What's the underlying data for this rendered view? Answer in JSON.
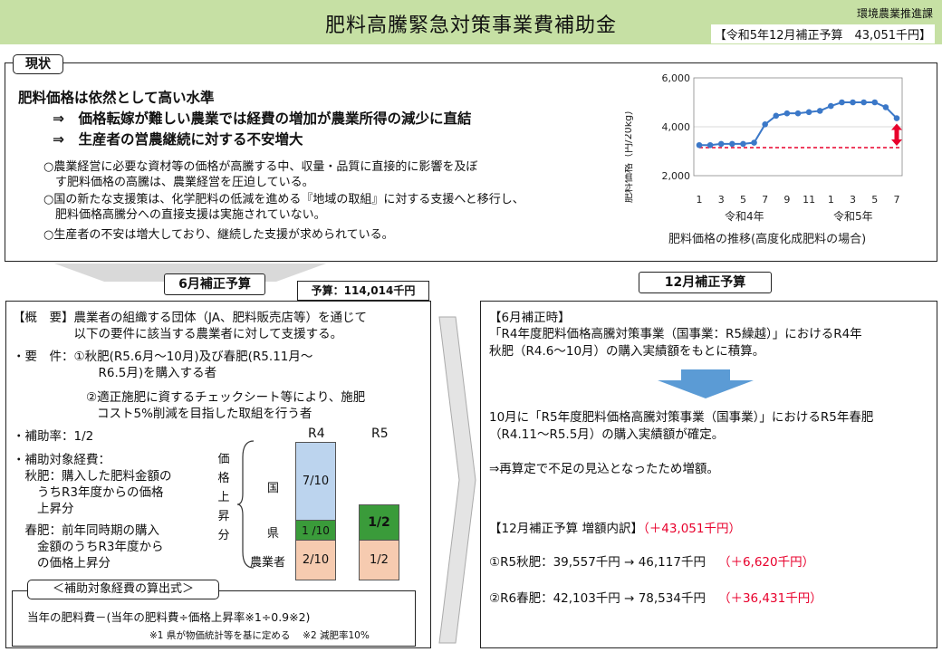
{
  "header": {
    "title": "肥料高騰緊急対策事業費補助金",
    "department": "環境農業推進課",
    "budget": "【令和5年12月補正予算　43,051千円】"
  },
  "status": {
    "label": "現状",
    "headline": "肥料価格は依然として高い水準",
    "sub1": "⇒　価格転嫁が難しい農業では経費の増加が農業所得の減少に直結",
    "sub2": "⇒　生産者の営農継続に対する不安増大",
    "bullets": [
      "○農業経営に必要な資材等の価格が高騰する中、収量・品質に直接的に影響を及ぼ",
      "　す肥料価格の高騰は、農業経営を圧迫している。",
      "○国の新たな支援策は、化学肥料の低減を進める『地域の取組』に対する支援へと移行し、",
      "　肥料価格高騰分への直接支援は実施されていない。",
      "○生産者の不安は増大しており、継続した支援が求められている。"
    ]
  },
  "chart_data": {
    "type": "line",
    "title": "肥料価格の推移(高度化成肥料の場合)",
    "ylabel": "肥料価格（円/20kg）",
    "ylim": [
      2000,
      6000
    ],
    "yticks": [
      "6,000",
      "4,000",
      "2,000"
    ],
    "xtick_labels": [
      "1",
      "3",
      "5",
      "7",
      "9",
      "11",
      "1",
      "3",
      "5",
      "7"
    ],
    "year_labels": [
      "令和4年",
      "令和5年"
    ],
    "x": [
      "R4.1",
      "R4.2",
      "R4.3",
      "R4.4",
      "R4.5",
      "R4.6",
      "R4.7",
      "R4.8",
      "R4.9",
      "R4.10",
      "R4.11",
      "R4.12",
      "R5.1",
      "R5.2",
      "R5.3",
      "R5.4",
      "R5.5",
      "R5.6",
      "R5.7"
    ],
    "values": [
      3250,
      3250,
      3300,
      3300,
      3300,
      3350,
      4100,
      4450,
      4550,
      4550,
      4600,
      4650,
      4850,
      5000,
      5000,
      5000,
      5000,
      4800,
      4350
    ],
    "reference_line": 3150,
    "grid": true,
    "colors": {
      "line": "#3b78c8",
      "reference": "#e8002c",
      "arrow": "#e8002c"
    }
  },
  "june": {
    "label": "6月補正予算",
    "budget": "予算：114,014千円",
    "overview1": "【概　要】農業者の組織する団体（JA、肥料販売店等）を通じて",
    "overview2": "　　　　　以下の要件に該当する農業者に対して支援する。",
    "req1": "・要　件：①秋肥(R5.6月～10月)及び春肥(R5.11月～",
    "req2": "　　　　　　　R6.5月)を購入する者",
    "req3": "②適正施肥に資するチェックシート等により、施肥",
    "req4": "コスト5%削減を目指した取組を行う者",
    "rate": "・補助率：1/2",
    "costs1": "・補助対象経費：",
    "costs2": "　秋肥：購入した肥料金額の",
    "costs3": "　　うちR3年度からの価格",
    "costs4": "　　上昇分",
    "costs5": "　春肥：前年同時期の購入",
    "costs6": "　　金額のうちR3年度から",
    "costs7": "　　の価格上昇分",
    "vertical_label": "価格上昇分",
    "r4": "R4",
    "r5": "R5",
    "row_national": "国",
    "row_pref": "県",
    "row_farmer": "農業者",
    "cell_national": "7/10",
    "cell_pref": "1 /10",
    "cell_farmer": "2/10",
    "cell_pref_r5": "1/2",
    "cell_farmer_r5": "1/2",
    "formula_label": "＜補助対象経費の算出式＞",
    "formula": "当年の肥料費－(当年の肥料費÷価格上昇率※1÷0.9※2)",
    "note": "※1 県が物価統計等を基に定める　 ※2 減肥率10%",
    "colors": {
      "national": "#bcd4ee",
      "pref": "#3a9b3a",
      "farmer": "#f6cbb0"
    }
  },
  "december": {
    "label": "12月補正予算",
    "p1": "【6月補正時】",
    "p2": "「R4年度肥料価格高騰対策事業（国事業：R5繰越）」におけるR4年",
    "p3": "秋肥（R4.6～10月）の購入実績額をもとに積算。",
    "p4": "10月に「R5年度肥料価格高騰対策事業（国事業）」におけるR5年春肥",
    "p5": "（R4.11～R5.5月）の購入実績額が確定。",
    "p6": "⇒再算定で不足の見込となったため増額。",
    "breakdown_title": "【12月補正予算  増額内訳】",
    "breakdown_total": "（＋43,051千円）",
    "line1": "①R5秋肥：39,557千円 → 46,117千円",
    "line1_diff": "（＋6,620千円）",
    "line2": "②R6春肥：42,103千円 → 78,534千円",
    "line2_diff": "（＋36,431千円）"
  }
}
